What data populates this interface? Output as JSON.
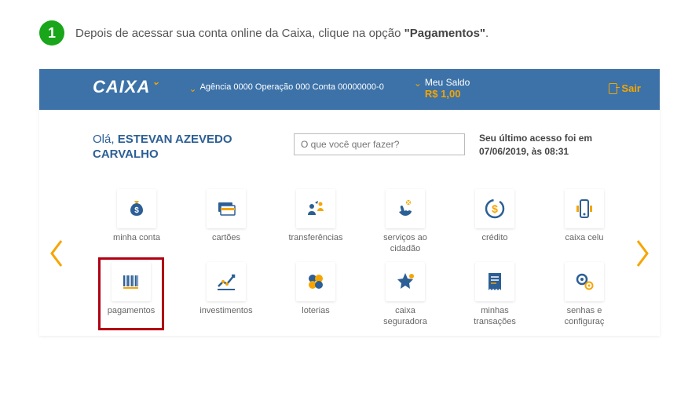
{
  "instruction": {
    "step": "1",
    "text_before": "Depois de acessar sua conta online da Caixa, clique na opção ",
    "text_bold": "\"Pagamentos\"",
    "text_after": "."
  },
  "topbar": {
    "logo": "CAIXA",
    "account_label": "Agência 0000 Operação 000 Conta 00000000-0",
    "saldo_label": "Meu Saldo",
    "saldo_value": "R$ 1,00",
    "sair": "Sair"
  },
  "midbar": {
    "greeting_prefix": "Olá, ",
    "greeting_name": "ESTEVAN AZEVEDO CARVALHO",
    "search_placeholder": "O que você quer fazer?",
    "last_access_prefix": "Seu último acesso foi em ",
    "last_access_date": "07/06/2019, às 08:31"
  },
  "tiles": [
    {
      "label": "minha conta",
      "icon": "money-bag"
    },
    {
      "label": "cartões",
      "icon": "cards"
    },
    {
      "label": "transferências",
      "icon": "transfer"
    },
    {
      "label": "serviços ao cidadão",
      "icon": "hand"
    },
    {
      "label": "crédito",
      "icon": "credit"
    },
    {
      "label": "caixa celu",
      "icon": "mobile"
    },
    {
      "label": "pagamentos",
      "icon": "barcode",
      "highlight": true
    },
    {
      "label": "investimentos",
      "icon": "chart"
    },
    {
      "label": "loterias",
      "icon": "clover"
    },
    {
      "label": "caixa seguradora",
      "icon": "star"
    },
    {
      "label": "minhas transações",
      "icon": "receipt"
    },
    {
      "label": "senhas e configuraç",
      "icon": "gears"
    }
  ]
}
